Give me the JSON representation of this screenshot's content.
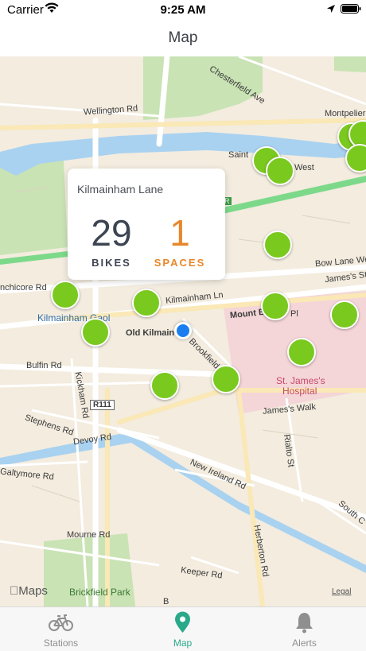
{
  "status_bar": {
    "carrier": "Carrier",
    "time": "9:25 AM"
  },
  "nav": {
    "title": "Map"
  },
  "map": {
    "labels": {
      "chesterfield": "Chesterfield Ave",
      "wellington": "Wellington Rd",
      "montpelier": "Montpelier",
      "saint": "Saint",
      "west": "West",
      "inchicore": "nchicore Rd",
      "bow_lane": "Bow Lane West",
      "james_st": "James's St",
      "kilmainham_ln": "Kilmainham Ln",
      "kilmainham_gaol": "Kilmainham Gaol",
      "old_kilmainham": "Old Kilmain",
      "mount_brown": "Mount B",
      "pl": "Pl",
      "brookfield": "Brookfield",
      "bulfin": "Bulfin Rd",
      "kickham": "Kickham Rd",
      "stephens": "Stephens Rd",
      "devoy": "Devoy Rd",
      "r111": "R111",
      "r": "R",
      "st_james": "St. James's",
      "hospital": "Hospital",
      "james_walk": "James's Walk",
      "rialto": "Rialto St",
      "galtymore": "Galtymore Rd",
      "new_ireland": "New Ireland Rd",
      "south_c": "South C",
      "mourne": "Mourne Rd",
      "herberton": "Herberton Rd",
      "keeper": "Keeper Rd",
      "brickfield": "Brickfield Park",
      "b": "B"
    },
    "maps_logo": "Maps",
    "legal": "Legal"
  },
  "callout": {
    "station_name": "Kilmainham Lane",
    "bikes": "29",
    "bikes_label": "BIKES",
    "spaces": "1",
    "spaces_label": "SPACES"
  },
  "tabs": [
    {
      "label": "Stations",
      "icon": "bicycle-icon"
    },
    {
      "label": "Map",
      "icon": "map-pin-icon",
      "active": true
    },
    {
      "label": "Alerts",
      "icon": "bell-icon"
    }
  ],
  "colors": {
    "accent": "#2aa98a",
    "pin_green": "#7ac91f",
    "bikes": "#3d4452",
    "spaces": "#e8862a",
    "user_location": "#1a7ef0"
  }
}
